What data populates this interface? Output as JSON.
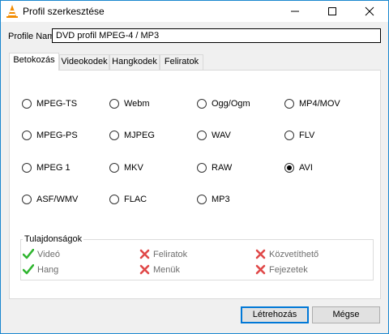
{
  "window": {
    "title": "Profil szerkesztése"
  },
  "profile": {
    "label": "Profile Name",
    "value": "DVD profil MPEG-4 / MP3"
  },
  "tabs": [
    {
      "label": "Betokozás",
      "active": true
    },
    {
      "label": "Videokodek",
      "active": false
    },
    {
      "label": "Hangkodek",
      "active": false
    },
    {
      "label": "Feliratok",
      "active": false
    }
  ],
  "containers": [
    {
      "label": "MPEG-TS",
      "checked": false
    },
    {
      "label": "Webm",
      "checked": false
    },
    {
      "label": "Ogg/Ogm",
      "checked": false
    },
    {
      "label": "MP4/MOV",
      "checked": false
    },
    {
      "label": "MPEG-PS",
      "checked": false
    },
    {
      "label": "MJPEG",
      "checked": false
    },
    {
      "label": "WAV",
      "checked": false
    },
    {
      "label": "FLV",
      "checked": false
    },
    {
      "label": "MPEG 1",
      "checked": false
    },
    {
      "label": "MKV",
      "checked": false
    },
    {
      "label": "RAW",
      "checked": false
    },
    {
      "label": "AVI",
      "checked": true
    },
    {
      "label": "ASF/WMV",
      "checked": false
    },
    {
      "label": "FLAC",
      "checked": false
    },
    {
      "label": "MP3",
      "checked": false
    }
  ],
  "properties": {
    "title": "Tulajdonságok",
    "items": [
      {
        "label": "Videó",
        "supported": true
      },
      {
        "label": "Feliratok",
        "supported": false
      },
      {
        "label": "Közvetíthető",
        "supported": false
      },
      {
        "label": "Hang",
        "supported": true
      },
      {
        "label": "Menük",
        "supported": false
      },
      {
        "label": "Fejezetek",
        "supported": false
      }
    ]
  },
  "buttons": {
    "create": "Létrehozás",
    "cancel": "Mégse"
  },
  "colors": {
    "check": "#2fb52f",
    "cross": "#e04848",
    "accent": "#0078d7"
  }
}
